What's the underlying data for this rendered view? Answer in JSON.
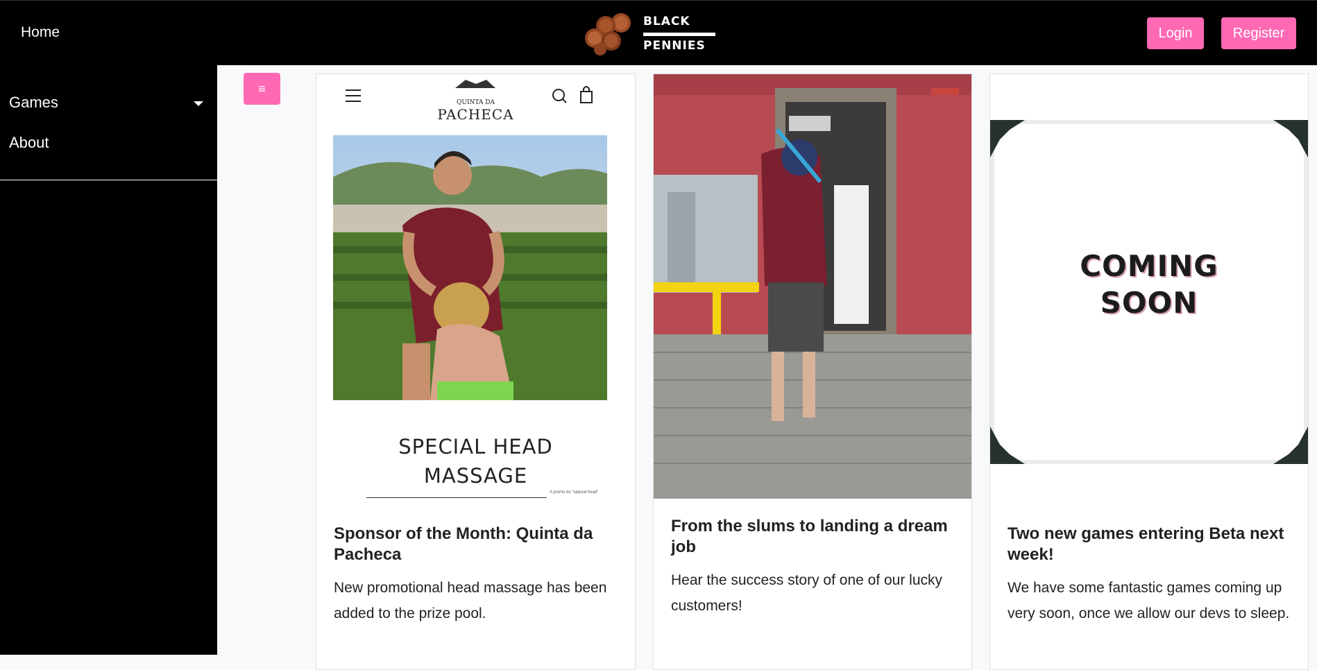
{
  "header": {
    "home_label": "Home",
    "logo_text_top": "BLACK",
    "logo_text_bottom": "PENNIES",
    "login_label": "Login",
    "register_label": "Register"
  },
  "sidebar": {
    "items": [
      {
        "label": "Games"
      },
      {
        "label": "About"
      }
    ],
    "toggle_label": "≡"
  },
  "cards": [
    {
      "image": {
        "brand_small": "QUINTA DA",
        "brand_name": "PACHECA",
        "headline_1": "SPECIAL HEAD",
        "headline_2": "MASSAGE",
        "caption": "A promo do \"special head\""
      },
      "title": "Sponsor of the Month: Quinta da Pacheca",
      "text": "New promotional head massage has been added to the prize pool."
    },
    {
      "title": "From the slums to landing a dream job",
      "text": "Hear the success story of one of our lucky customers!"
    },
    {
      "image": {
        "line_1": "COMING",
        "line_2": "SOON"
      },
      "title": "Two new games entering Beta next week!",
      "text": "We have some fantastic games coming up very soon, once we allow our devs to sleep."
    }
  ],
  "colors": {
    "accent": "#ff69b4",
    "navbar": "#000000",
    "page_bg": "#f8f9fa"
  }
}
